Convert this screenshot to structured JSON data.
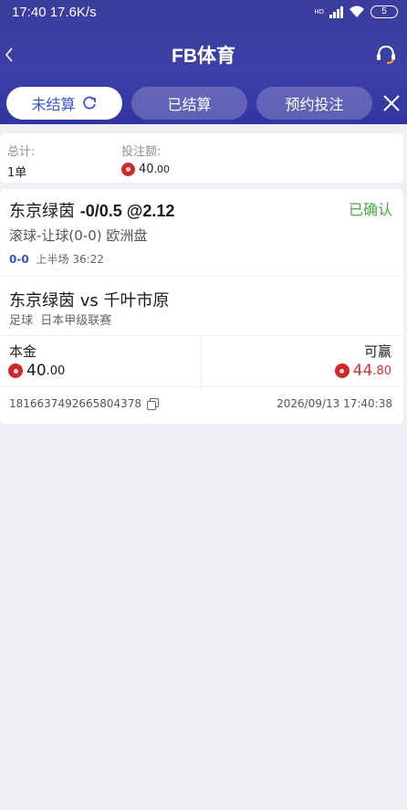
{
  "status_bar": {
    "time": "17:40",
    "speed": "17.6K/s",
    "network": "HD",
    "battery": "5"
  },
  "header": {
    "title": "FB体育",
    "back_icon": "chevron-left-icon",
    "support_icon": "headset-icon"
  },
  "tabs": [
    {
      "label": "未结算",
      "active": true
    },
    {
      "label": "已结算",
      "active": false
    },
    {
      "label": "预约投注",
      "active": false
    }
  ],
  "summary": {
    "total_label": "总计:",
    "total_value": "1单",
    "bet_amount_label": "投注额:",
    "bet_amount_int": "40",
    "bet_amount_dec": ".00"
  },
  "bet": {
    "team": "东京绿茵",
    "handicap": "-0/0.5 @2.12",
    "status": "已确认",
    "market": "滚球-让球(0-0) 欧洲盘",
    "score": "0-0",
    "period": "上半场 36:22",
    "match": "东京绿茵 vs 千叶市原",
    "sport": "足球",
    "league": "日本甲级联赛",
    "stake_label": "本金",
    "stake_int": "40",
    "stake_dec": ".00",
    "win_label": "可赢",
    "win_int": "44",
    "win_dec": ".80",
    "order_id": "1816637492665804378",
    "time": "2026/09/13 17:40:38"
  },
  "colors": {
    "header": "#3a3d9c",
    "accent": "#3c52c6",
    "confirmed": "#4aa647",
    "win": "#d0303a"
  }
}
